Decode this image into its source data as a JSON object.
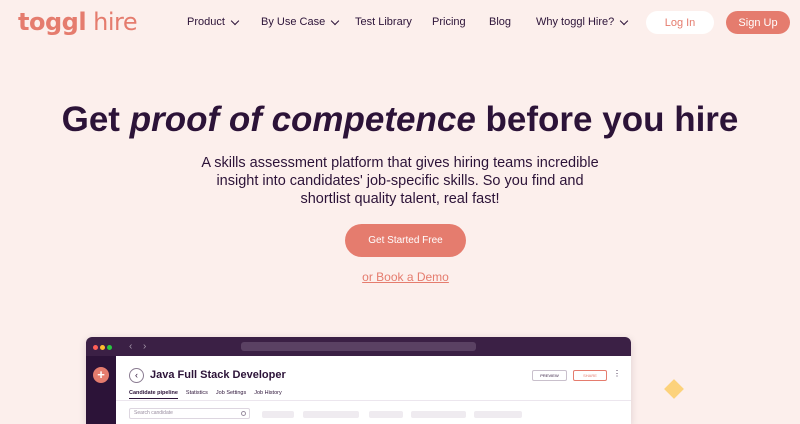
{
  "header": {
    "logo_bold": "toggl",
    "logo_light": " hire",
    "nav": [
      {
        "label": "Product",
        "has_dropdown": true
      },
      {
        "label": "By Use Case",
        "has_dropdown": true
      },
      {
        "label": "Test Library",
        "has_dropdown": false
      },
      {
        "label": "Pricing",
        "has_dropdown": false
      },
      {
        "label": "Blog",
        "has_dropdown": false
      },
      {
        "label": "Why toggl Hire?",
        "has_dropdown": true
      }
    ],
    "login_label": "Log In",
    "signup_label": "Sign Up"
  },
  "hero": {
    "title_before": "Get ",
    "title_emphasis": "proof of competence",
    "title_after": " before you hire",
    "subtitle": "A skills assessment platform that gives hiring teams incredible insight into candidates' job-specific skills. So you find and shortlist quality talent, real fast!",
    "cta_label": "Get Started Free",
    "demo_link": "or Book a Demo"
  },
  "app_window": {
    "job_title": "Java Full Stack Developer",
    "preview_label": "PREVIEW",
    "share_label": "SHARE",
    "tabs": [
      "Candidate pipeline",
      "Statistics",
      "Job Settings",
      "Job History"
    ],
    "search_placeholder": "Search candidate"
  },
  "colors": {
    "background": "#fcefec",
    "accent": "#e57c6e",
    "text": "#2c1338",
    "window_dark": "#3b2045"
  }
}
